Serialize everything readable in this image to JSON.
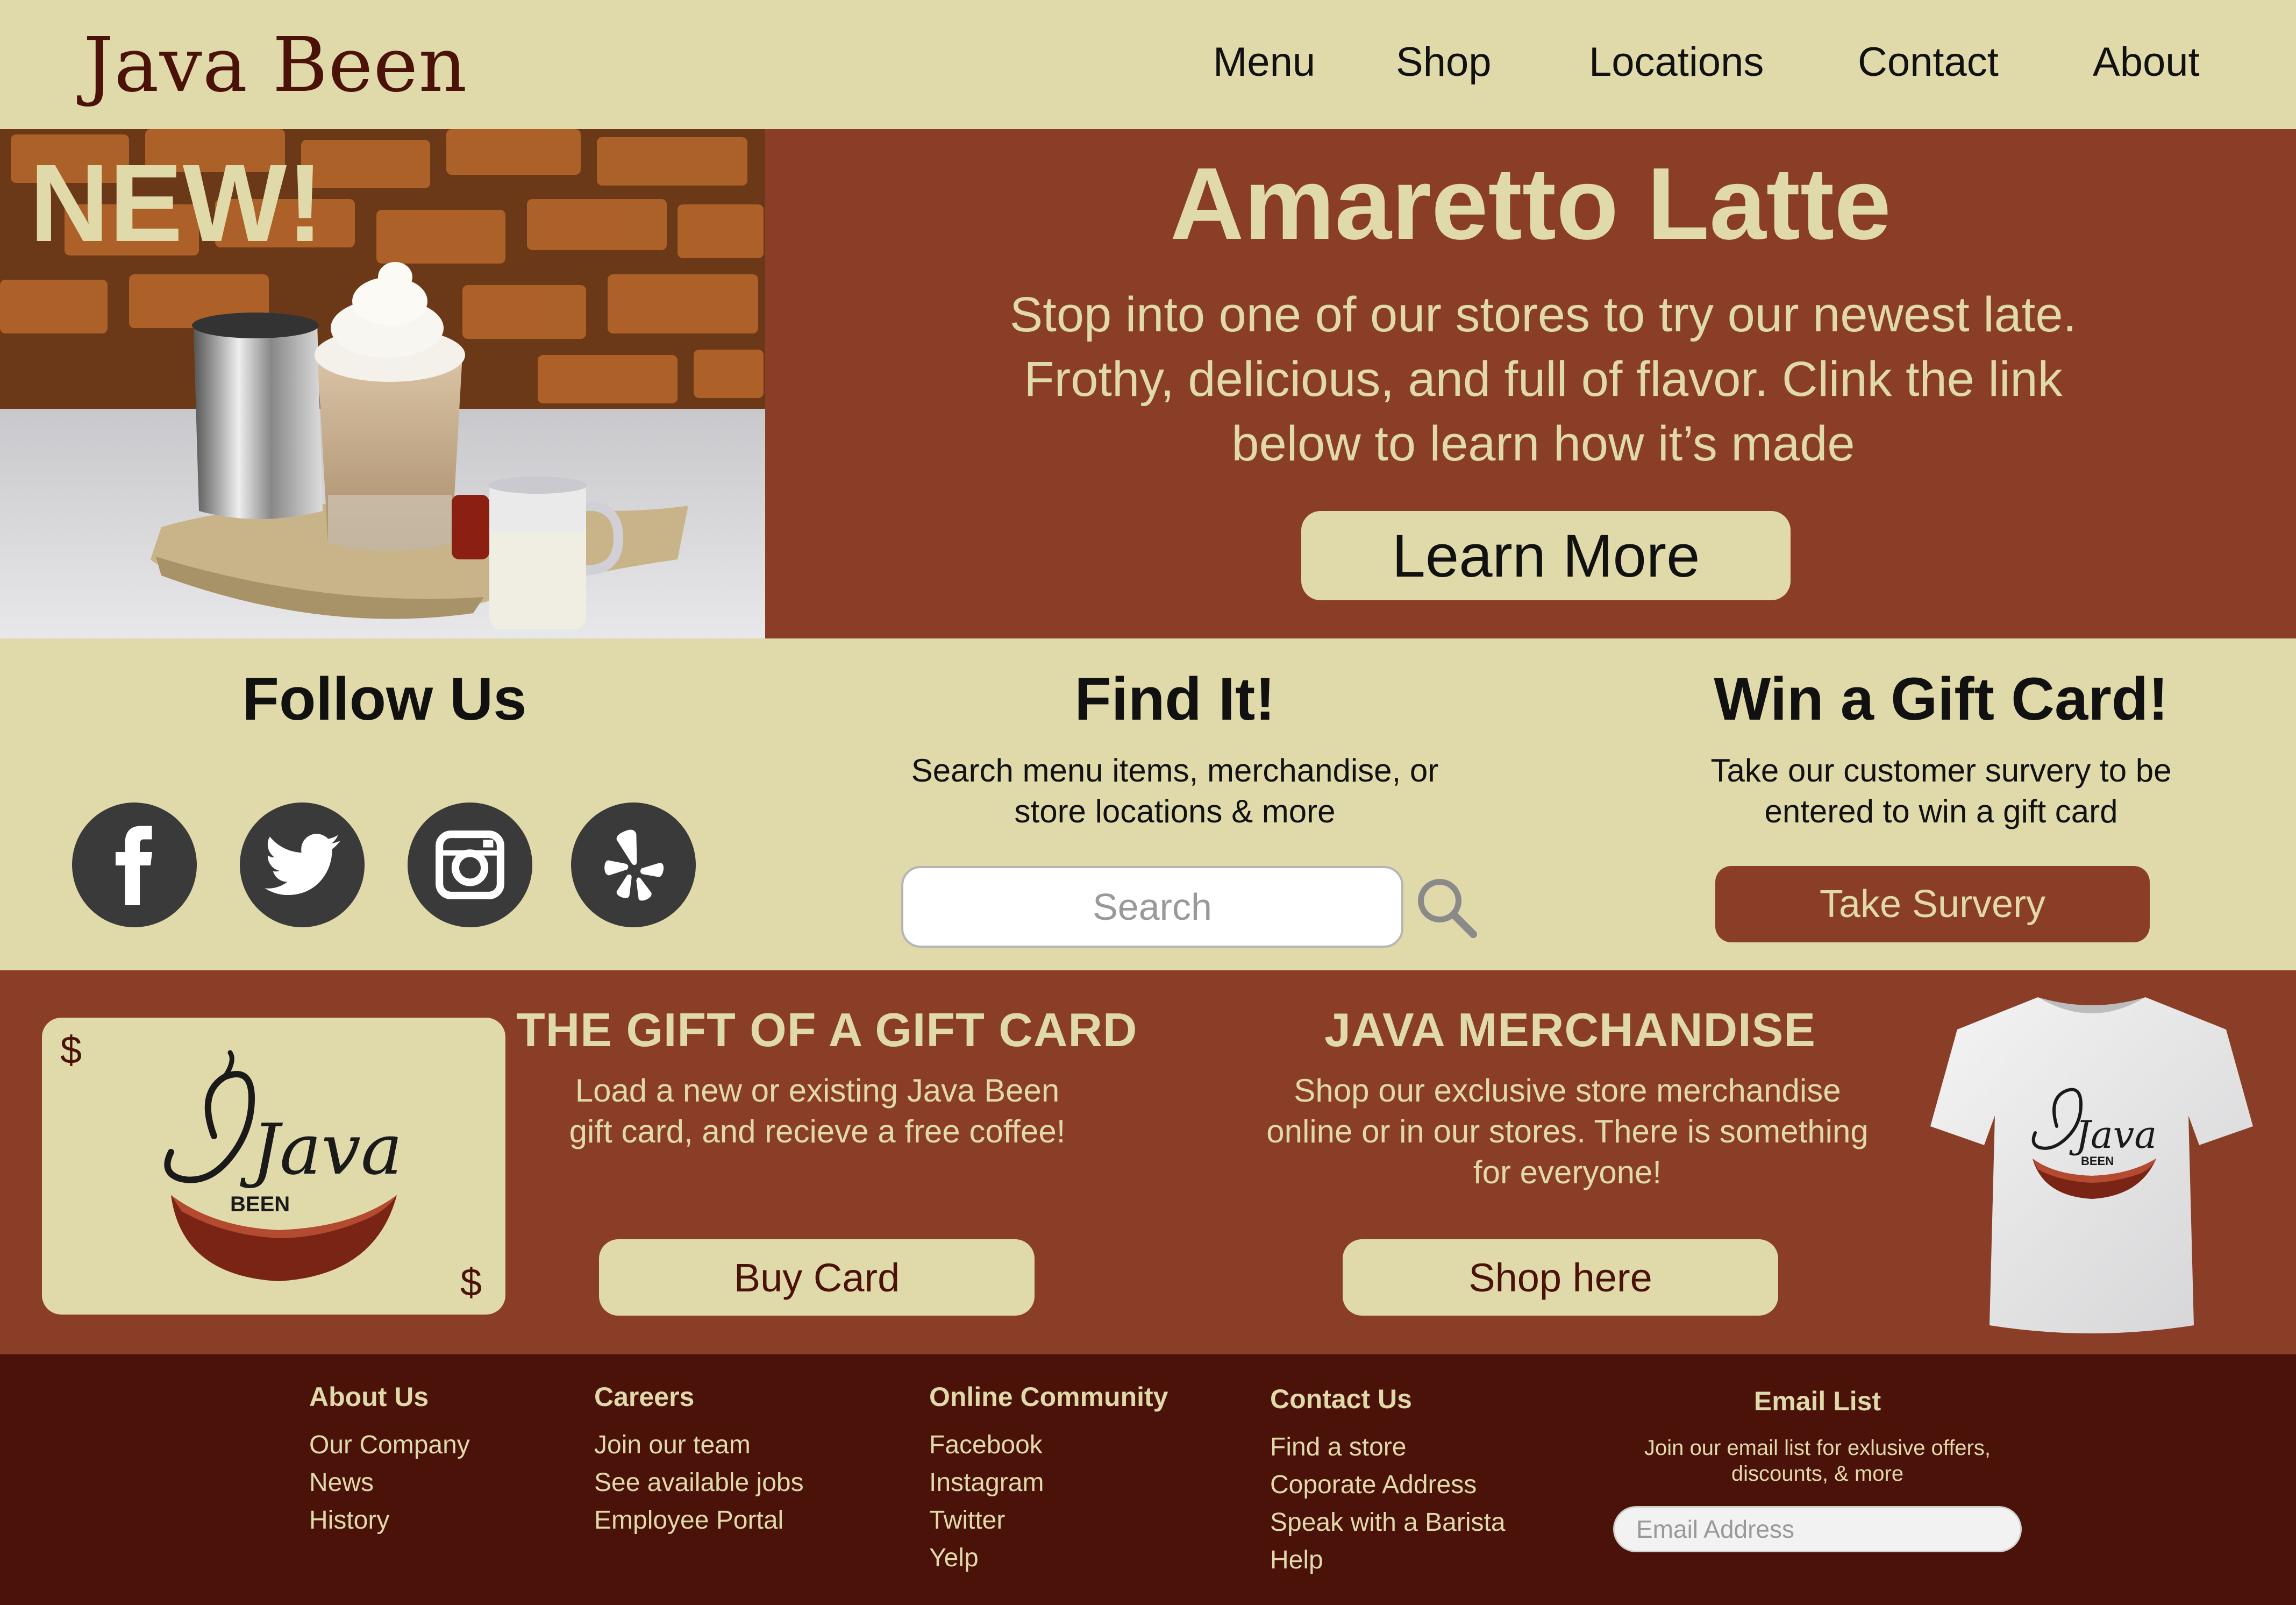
{
  "header": {
    "logo": "Java Been",
    "nav": [
      "Menu",
      "Shop",
      "Locations",
      "Contact",
      "About"
    ]
  },
  "hero": {
    "badge": "NEW!",
    "title": "Amaretto Latte",
    "description": "Stop into one of our stores to try our newest late. Frothy, delicious, and full of flavor. Clink the link below to learn how it’s made",
    "button_label": "Learn More"
  },
  "follow": {
    "title": "Follow Us",
    "icons": [
      "facebook-icon",
      "twitter-icon",
      "instagram-icon",
      "yelp-icon"
    ]
  },
  "find": {
    "title": "Find It!",
    "description": "Search menu items, merchandise, or store locations & more",
    "search_placeholder": "Search"
  },
  "gift_survey": {
    "title": "Win a Gift Card!",
    "description": "Take our customer survery to be entered to win a gift card",
    "button_label": "Take Survery"
  },
  "gift_card_promo": {
    "currency_symbol": "$",
    "logo_text": "Java",
    "logo_subtext": "BEEN",
    "title": "THE GIFT OF A GIFT CARD",
    "description": "Load a new or existing Java Been gift card, and recieve a free coffee!",
    "button_label": "Buy Card"
  },
  "merch_promo": {
    "title": "JAVA MERCHANDISE",
    "description": "Shop our exclusive store merchandise online or in our stores. There is something for everyone!",
    "button_label": "Shop here",
    "tshirt_logo_text": "Java",
    "tshirt_logo_subtext": "BEEN"
  },
  "footer": {
    "columns": [
      {
        "title": "About Us",
        "links": [
          "Our Company",
          "News",
          "History"
        ]
      },
      {
        "title": "Careers",
        "links": [
          "Join our team",
          "See available jobs",
          "Employee Portal"
        ]
      },
      {
        "title": "Online Community",
        "links": [
          "Facebook",
          "Instagram",
          "Twitter",
          "Yelp"
        ]
      },
      {
        "title": "Contact Us",
        "links": [
          "Find a store",
          "Coporate Address",
          "Speak with a Barista",
          "Help"
        ]
      }
    ],
    "email": {
      "title": "Email List",
      "description": "Join our email list for exlusive offers, discounts, & more",
      "placeholder": "Email Address"
    }
  },
  "colors": {
    "cream": "#e0d9aa",
    "rust": "#8b3e27",
    "dark_brown": "#4a1208",
    "icon_gray": "#3a3a3a"
  }
}
